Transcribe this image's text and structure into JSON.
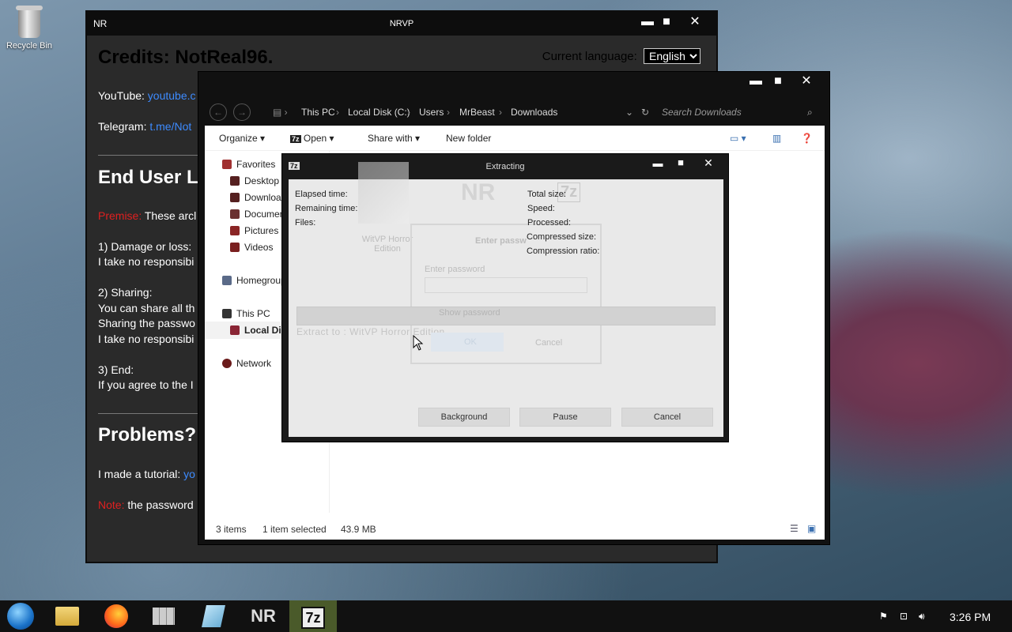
{
  "desktop": {
    "recycle_bin": "Recycle Bin"
  },
  "nrvp": {
    "title_left": "NR",
    "title": "NRVP",
    "credits": "Credits: NotReal96.",
    "lang_label": "Current language:",
    "lang_value": "English",
    "youtube_label": "YouTube:",
    "youtube_link": "youtube.c",
    "telegram_label": "Telegram:",
    "telegram_link": "t.me/Not",
    "eula_heading": "End User L",
    "premise_label": "Premise:",
    "premise_text": "These arcl",
    "damage_head": "1) Damage or loss:",
    "damage_text": "I take no responsibi",
    "sharing_head": "2) Sharing:",
    "sharing_text1": "You can share all th",
    "sharing_text2": "Sharing the passwo",
    "sharing_text3": "I take no responsibi",
    "end_head": "3) End:",
    "end_text": "If you agree to the I",
    "problems_heading": "Problems?",
    "tutorial_text": "I made a tutorial:",
    "tutorial_link": "yo",
    "note_label": "Note:",
    "note_text": "the password"
  },
  "explorer": {
    "breadcrumb": [
      "This PC",
      "Local Disk (C:)",
      "Users",
      "MrBeast",
      "Downloads"
    ],
    "search_placeholder": "Search Downloads",
    "commands": {
      "organize": "Organize",
      "open": "Open",
      "share": "Share with",
      "new_folder": "New folder"
    },
    "nav": {
      "favorites": "Favorites",
      "desktop": "Desktop",
      "downloads": "Downloads",
      "documents": "Documents",
      "pictures": "Pictures",
      "videos": "Videos",
      "homegroup": "Homegroup",
      "this_pc": "This PC",
      "local_disk": "Local Disk (C:)",
      "network": "Network"
    },
    "status": {
      "items": "3 items",
      "selected": "1 item selected",
      "size": "43.9 MB"
    }
  },
  "extract": {
    "title": "Extracting",
    "elapsed": "Elapsed time:",
    "remaining": "Remaining time:",
    "files": "Files:",
    "total": "Total size:",
    "speed": "Speed:",
    "processed": "Processed:",
    "compressed": "Compressed size:",
    "ratio": "Compression ratio:",
    "background": "Background",
    "pause": "Pause",
    "cancel": "Cancel",
    "ghost_app": "WitVP Horror Edition",
    "ghost_nr": "NR",
    "ghost_pw_title": "Enter passw",
    "ghost_pw_label": "Enter password",
    "ghost_show": "Show password",
    "ghost_ok": "OK",
    "ghost_cancel": "Cancel",
    "ghost_extract_to": "Extract to : WitVP Horror Edition"
  },
  "taskbar": {
    "clock": "3:26 PM",
    "nr_label": "NR",
    "sevenzip_label": "7z"
  }
}
